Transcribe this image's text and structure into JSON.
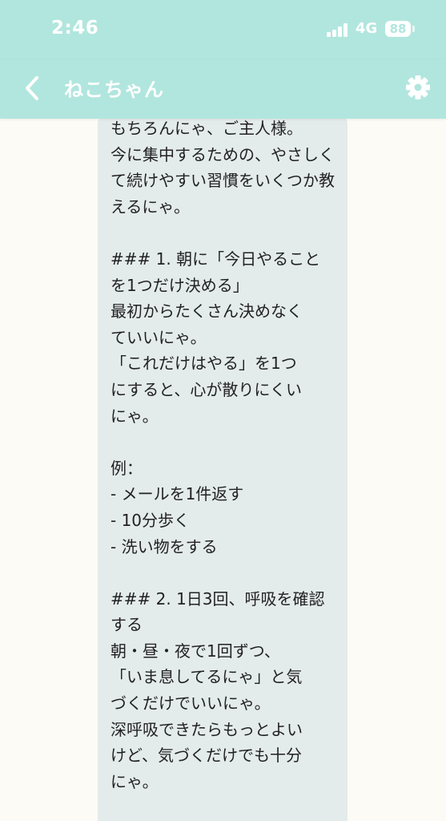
{
  "status_bar": {
    "time": "2:46",
    "network": "4G",
    "battery": "88"
  },
  "header": {
    "title": "ねこちゃん",
    "background_color": "#b1e6de"
  },
  "icons": {
    "back": "chevron-left-icon",
    "settings": "gear-icon"
  },
  "message": {
    "text": "もちろんにゃ、ご主人様。\n今に集中するための、やさしくて続けやすい習慣をいくつか教えるにゃ。\n\n### 1. 朝に「今日やること\nを1つだけ決める」\n最初からたくさん決めなく\nていいにゃ。\n「これだけはやる」を1つ\nにすると、心が散りにくい\nにゃ。\n\n例：\n- メールを1件返す\n- 10分歩く\n- 洗い物をする\n\n### 2. 1日3回、呼吸を確認\nする\n朝・昼・夜で1回ずつ、\n「いま息してるにゃ」と気\nづくだけでいいにゃ。\n深呼吸できたらもっとよい\nけど、気づくだけでも十分\nにゃ。"
  }
}
